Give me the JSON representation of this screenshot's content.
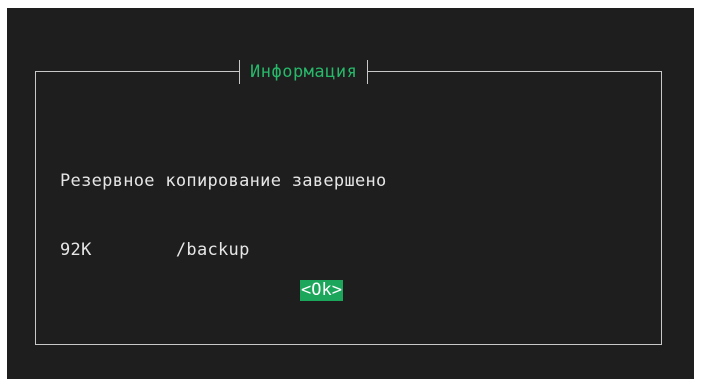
{
  "dialog": {
    "title": "Информация",
    "lines": [
      "Резервное копирование завершено",
      "92K        /backup"
    ],
    "ok_label": "<Ok>"
  },
  "colors": {
    "background": "#1e1e1e",
    "frame": "#c8c8c8",
    "title": "#27b96a",
    "text": "#e6e6e6",
    "button_bg": "#1ca65c",
    "button_text": "#ffffff"
  }
}
